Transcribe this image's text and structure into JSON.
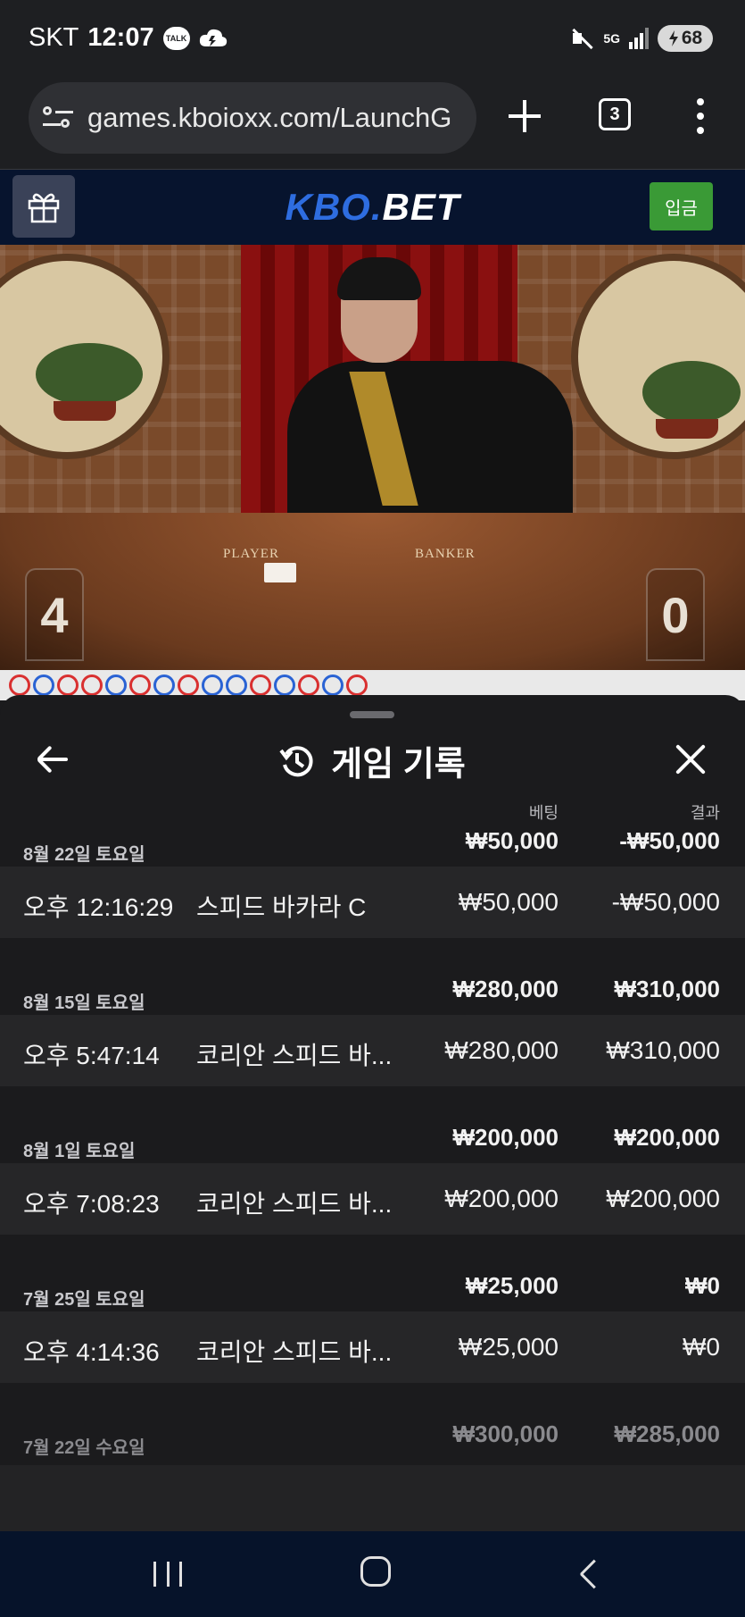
{
  "status_bar": {
    "carrier": "SKT",
    "time": "12:07",
    "talk_icon_label": "TALK",
    "network": "5G",
    "battery": "68"
  },
  "browser": {
    "url": "games.kboioxx.com/LaunchG",
    "tab_count": "3"
  },
  "site_header": {
    "logo_part1": "KBO.",
    "logo_part2": "BET",
    "deposit_label": "입금",
    "brand_color": "#2e6de0",
    "deposit_color": "#3a9a36"
  },
  "video": {
    "table_player_label": "PLAYER",
    "table_banker_label": "BANKER",
    "player_score": "4",
    "banker_score": "0"
  },
  "sheet": {
    "title": "게임 기록",
    "col_bet": "베팅",
    "col_result": "결과",
    "groups": [
      {
        "date": "8월 22일 토요일",
        "bet_total": "₩50,000",
        "result_total": "-₩50,000",
        "record": {
          "time": "오후 12:16:29",
          "game": "스피드 바카라 C",
          "bet": "₩50,000",
          "result": "-₩50,000"
        }
      },
      {
        "date": "8월 15일 토요일",
        "bet_total": "₩280,000",
        "result_total": "₩310,000",
        "record": {
          "time": "오후 5:47:14",
          "game": "코리안 스피드 바...",
          "bet": "₩280,000",
          "result": "₩310,000"
        }
      },
      {
        "date": "8월 1일 토요일",
        "bet_total": "₩200,000",
        "result_total": "₩200,000",
        "record": {
          "time": "오후 7:08:23",
          "game": "코리안 스피드 바...",
          "bet": "₩200,000",
          "result": "₩200,000"
        }
      },
      {
        "date": "7월 25일 토요일",
        "bet_total": "₩25,000",
        "result_total": "₩0",
        "record": {
          "time": "오후 4:14:36",
          "game": "코리안 스피드 바...",
          "bet": "₩25,000",
          "result": "₩0"
        }
      },
      {
        "date": "7월 22일 수요일",
        "bet_total": "₩300,000",
        "result_total": "₩285,000"
      }
    ]
  }
}
